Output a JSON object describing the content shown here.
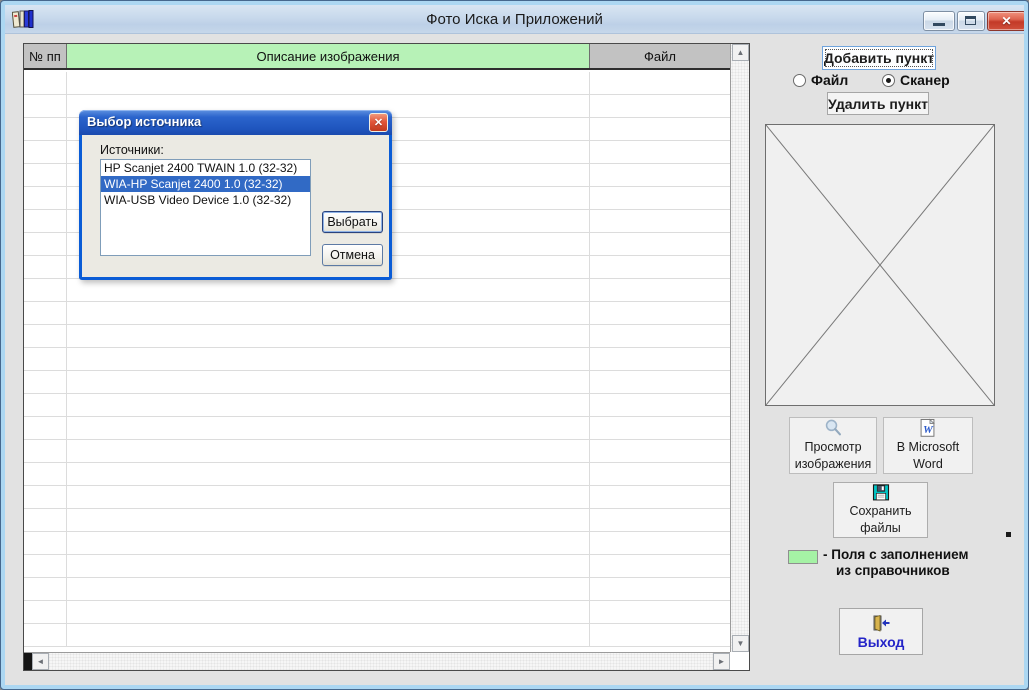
{
  "window": {
    "title": "Фото Иска и Приложений",
    "controls": {
      "close_glyph": "✕"
    }
  },
  "icons": {
    "up": "▲",
    "down": "▼",
    "left": "◄",
    "right": "►"
  },
  "table": {
    "columns": [
      "№ пп",
      "Описание изображения",
      "Файл"
    ],
    "row_count": 25
  },
  "dialog": {
    "title": "Выбор источника",
    "close_glyph": "✕",
    "sources_label": "Источники:",
    "items": [
      "HP Scanjet 2400 TWAIN 1.0 (32-32)",
      "WIA-HP Scanjet 2400 1.0 (32-32)",
      "WIA-USB Video Device 1.0 (32-32)"
    ],
    "selected_index": 1,
    "select_button": "Выбрать",
    "cancel_button": "Отмена"
  },
  "panel": {
    "add_button": "Добавить пункт",
    "radio_file": "Файл",
    "radio_scanner": "Сканер",
    "radio_selected": "Сканер",
    "delete_button": "Удалить пункт",
    "view_button": [
      "Просмотр",
      "изображения"
    ],
    "word_button": [
      "В Microsoft",
      "Word"
    ],
    "save_button": [
      "Сохранить",
      "файлы"
    ],
    "legend_line1": "- Поля с заполнением",
    "legend_line2": "из справочников",
    "exit_button": "Выход"
  },
  "colors": {
    "header_green": "#B7F2B7",
    "header_gray": "#C2C2C2",
    "selection_blue": "#316AC5",
    "legend_green": "#A5F2A5",
    "exit_text_blue": "#2424C8",
    "dialog_title_blue": "#2B64CC"
  }
}
